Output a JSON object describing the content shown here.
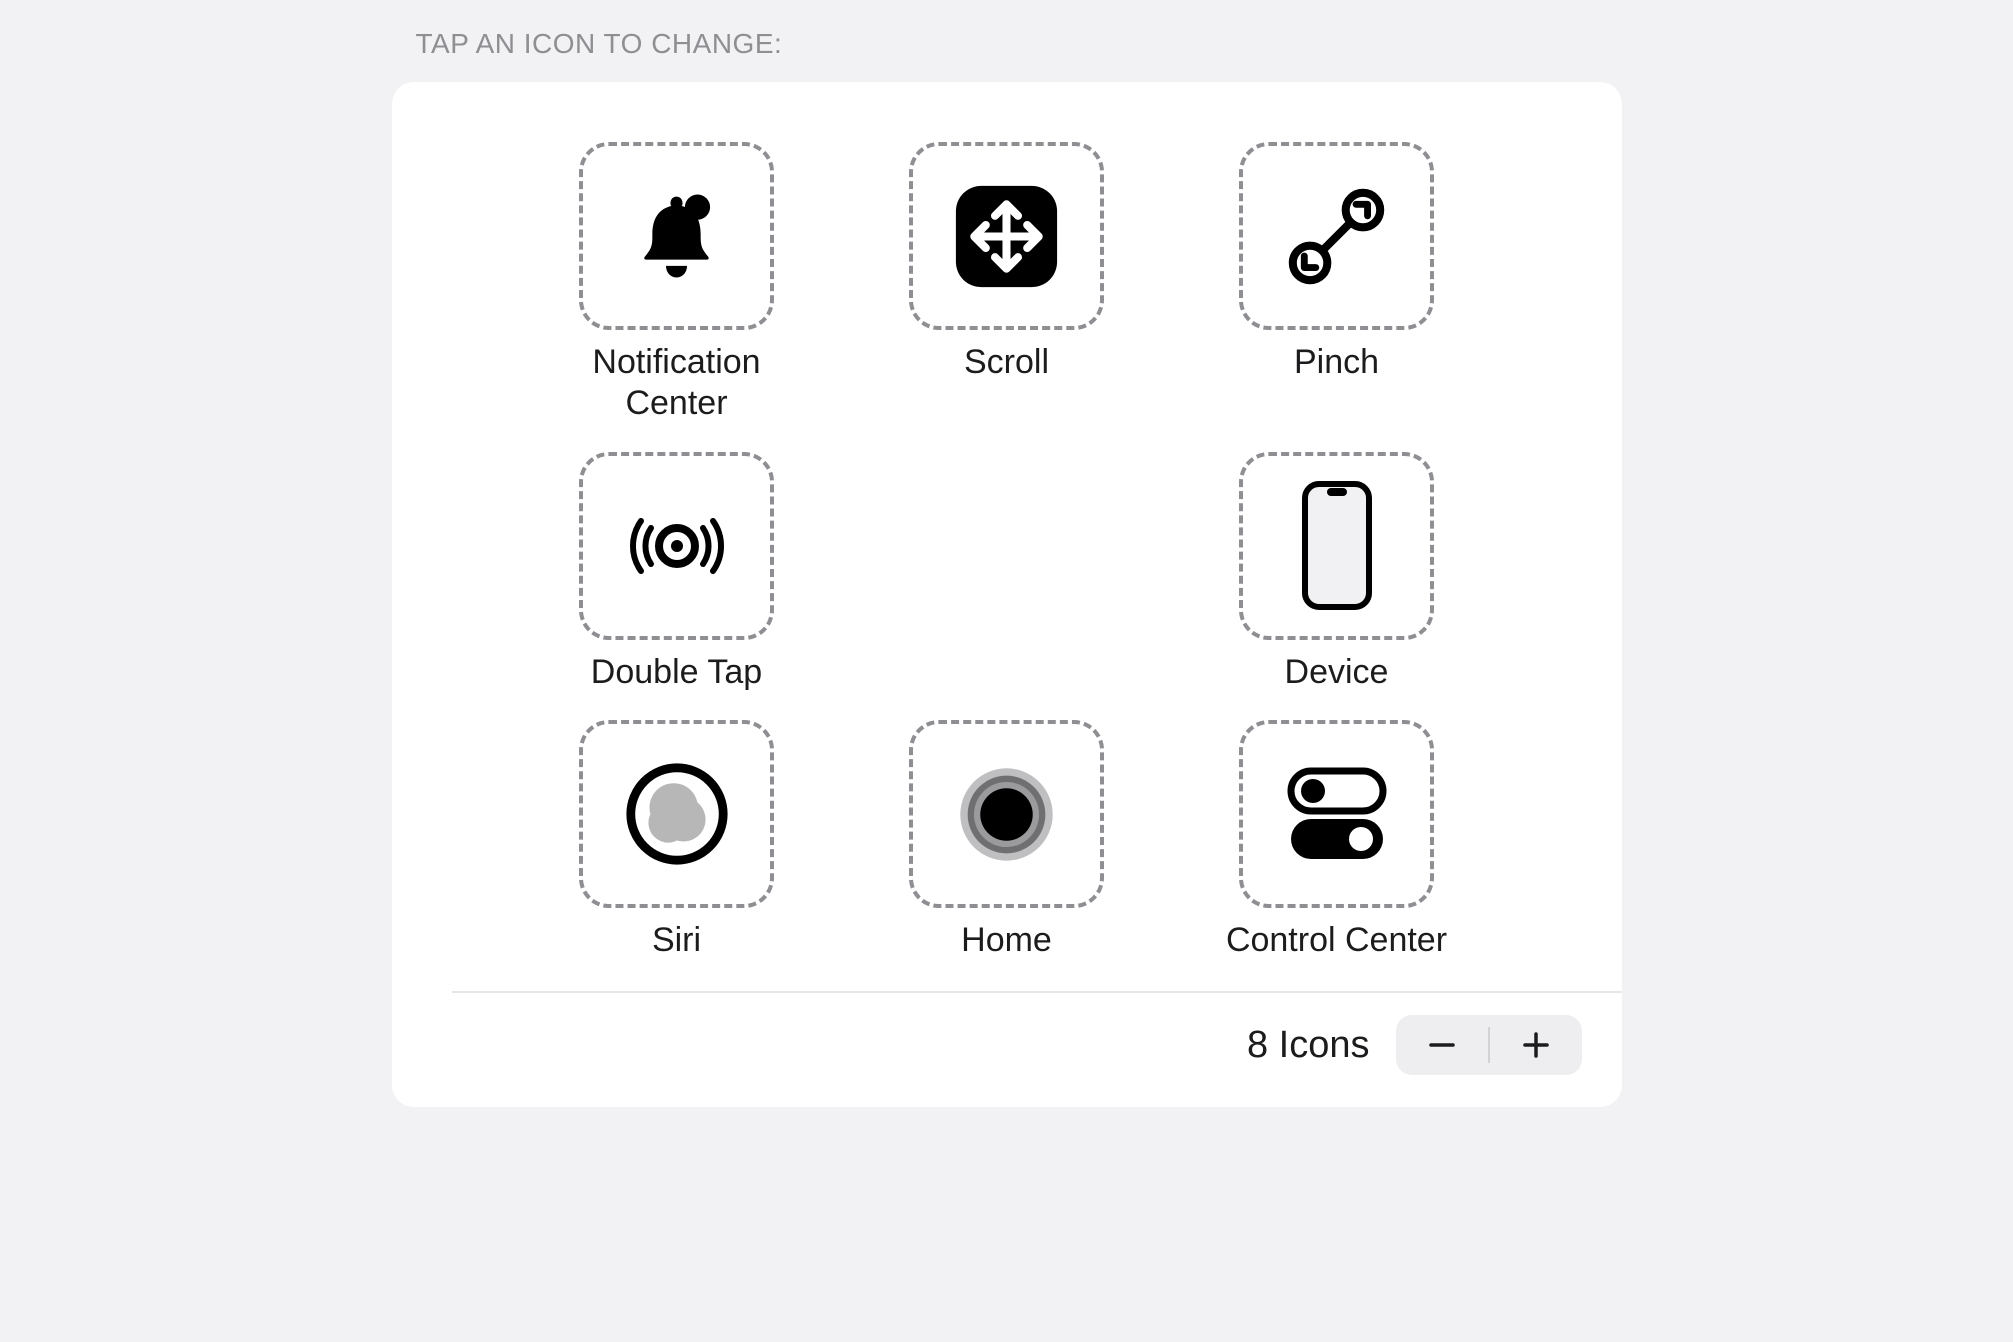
{
  "header": "TAP AN ICON TO CHANGE:",
  "items": [
    {
      "label": "Notification Center",
      "icon": "bell-badge-icon"
    },
    {
      "label": "Scroll",
      "icon": "scroll-arrows-icon"
    },
    {
      "label": "Pinch",
      "icon": "pinch-icon"
    },
    {
      "label": "Double Tap",
      "icon": "double-tap-icon"
    },
    {
      "label": "",
      "icon": ""
    },
    {
      "label": "Device",
      "icon": "iphone-icon"
    },
    {
      "label": "Siri",
      "icon": "siri-icon"
    },
    {
      "label": "Home",
      "icon": "home-button-icon"
    },
    {
      "label": "Control Center",
      "icon": "toggles-icon"
    }
  ],
  "stepper": {
    "label": "8 Icons"
  }
}
